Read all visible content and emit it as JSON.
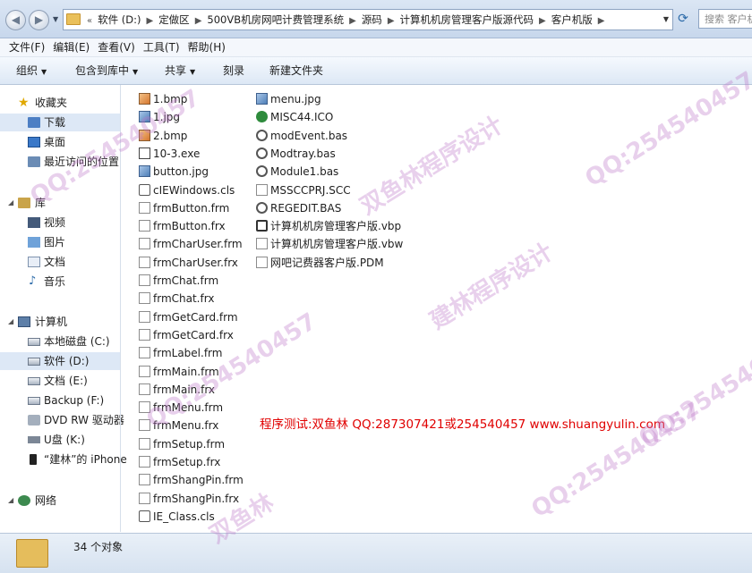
{
  "breadcrumbs": [
    "软件 (D:)",
    "定做区",
    "500VB机房网吧计费管理系统",
    "源码",
    "计算机机房管理客户版源代码",
    "客户机版"
  ],
  "search": {
    "placeholder": "搜索 客户机版"
  },
  "menu": [
    "文件(F)",
    "编辑(E)",
    "查看(V)",
    "工具(T)",
    "帮助(H)"
  ],
  "toolbar": {
    "organize": "组织",
    "include": "包含到库中",
    "share": "共享",
    "burn": "刻录",
    "new_folder": "新建文件夹"
  },
  "nav": {
    "favorites": "收藏夹",
    "downloads": "下载",
    "desktop": "桌面",
    "recent": "最近访问的位置",
    "libraries": "库",
    "videos": "视频",
    "pictures": "图片",
    "documents": "文档",
    "music": "音乐",
    "computer": "计算机",
    "local_c": "本地磁盘 (C:)",
    "soft_d": "软件 (D:)",
    "doc_e": "文档 (E:)",
    "backup_f": "Backup (F:)",
    "dvd": "DVD RW 驱动器",
    "usb_k": "U盘 (K:)",
    "iphone": "“建林”的 iPhone",
    "network": "网络"
  },
  "files_col1": [
    {
      "name": "1.bmp",
      "icon": "bmp-icon"
    },
    {
      "name": "1.jpg",
      "icon": "jpg-icon"
    },
    {
      "name": "2.bmp",
      "icon": "bmp-icon"
    },
    {
      "name": "10-3.exe",
      "icon": "exe-icon"
    },
    {
      "name": "button.jpg",
      "icon": "jpg-icon"
    },
    {
      "name": "cIEWindows.cls",
      "icon": "cls-icon"
    },
    {
      "name": "frmButton.frm",
      "icon": "form-icon"
    },
    {
      "name": "frmButton.frx",
      "icon": "file-icon"
    },
    {
      "name": "frmCharUser.frm",
      "icon": "form-icon"
    },
    {
      "name": "frmCharUser.frx",
      "icon": "file-icon"
    },
    {
      "name": "frmChat.frm",
      "icon": "form-icon"
    },
    {
      "name": "frmChat.frx",
      "icon": "file-icon"
    },
    {
      "name": "frmGetCard.frm",
      "icon": "form-icon"
    },
    {
      "name": "frmGetCard.frx",
      "icon": "file-icon"
    },
    {
      "name": "frmLabel.frm",
      "icon": "form-icon"
    },
    {
      "name": "frmMain.frm",
      "icon": "form-icon"
    },
    {
      "name": "frmMain.frx",
      "icon": "file-icon"
    },
    {
      "name": "frmMenu.frm",
      "icon": "form-icon"
    },
    {
      "name": "frmMenu.frx",
      "icon": "file-icon"
    },
    {
      "name": "frmSetup.frm",
      "icon": "form-icon"
    },
    {
      "name": "frmSetup.frx",
      "icon": "file-icon"
    },
    {
      "name": "frmShangPin.frm",
      "icon": "form-icon"
    },
    {
      "name": "frmShangPin.frx",
      "icon": "file-icon"
    },
    {
      "name": "IE_Class.cls",
      "icon": "cls-icon"
    }
  ],
  "files_col2": [
    {
      "name": "menu.jpg",
      "icon": "jpg-icon"
    },
    {
      "name": "MISC44.ICO",
      "icon": "ico-icon"
    },
    {
      "name": "modEvent.bas",
      "icon": "bas-icon"
    },
    {
      "name": "Modtray.bas",
      "icon": "bas-icon"
    },
    {
      "name": "Module1.bas",
      "icon": "bas-icon"
    },
    {
      "name": "MSSCCPRJ.SCC",
      "icon": "file-icon"
    },
    {
      "name": "REGEDIT.BAS",
      "icon": "bas-icon"
    },
    {
      "name": "计算机机房管理客户版.vbp",
      "icon": "vbp-icon"
    },
    {
      "name": "计算机机房管理客户版.vbw",
      "icon": "file-icon"
    },
    {
      "name": "网吧记费器客户版.PDM",
      "icon": "file-icon"
    }
  ],
  "promo": "程序测试:双鱼林 QQ:287307421或254540457 www.shuangyulin.com",
  "status": "34 个对象",
  "watermarks": [
    "QQ:254540457",
    "双鱼林程序设计",
    "QQ:254540457",
    "QQ:254540457",
    "建林程序设计",
    "QQ:254540457",
    "双鱼林",
    "QQ:254540457"
  ]
}
